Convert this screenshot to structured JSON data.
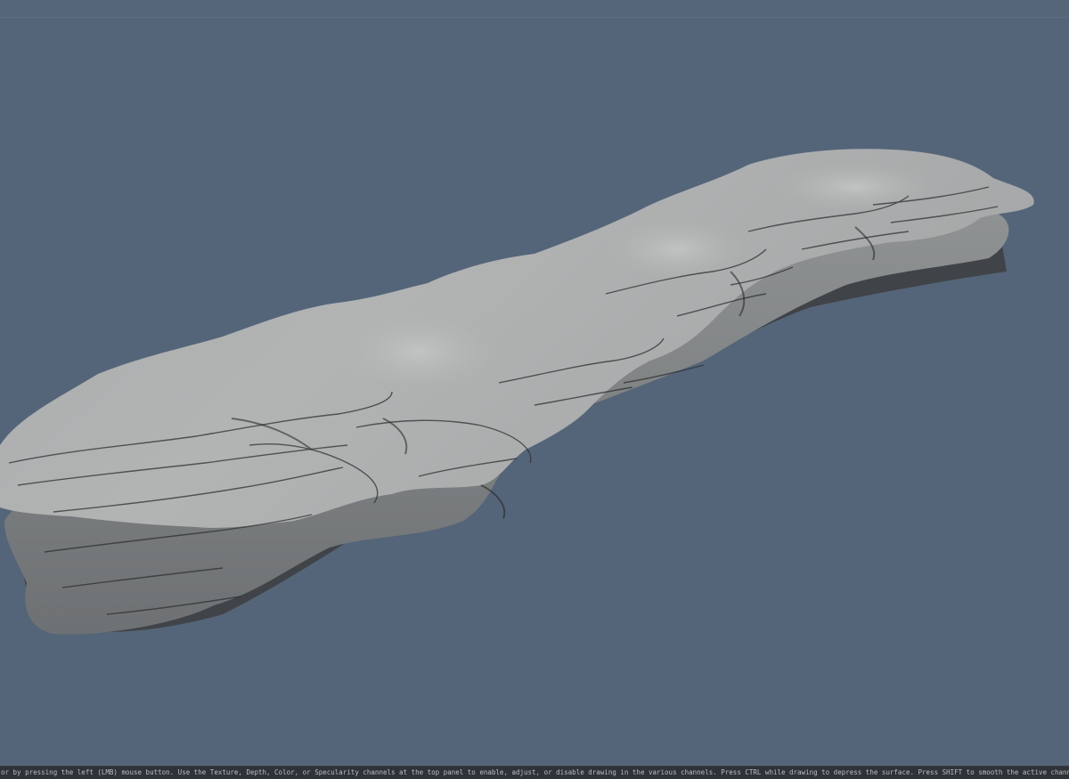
{
  "viewport": {
    "model": "sculpted-rock-slab",
    "background_color": "#55657a",
    "surface_color": "#a4a6a6",
    "shadow_color": "#404143"
  },
  "status_bar": {
    "text": "or by pressing the left (LMB) mouse button. Use the Texture, Depth, Color, or Specularity channels at the top panel to enable, adjust, or disable drawing in the various channels. Press CTRL while drawing to depress the surface. Press SHIFT to smooth the active channel(s) while you draw. Navigate the camera with"
  }
}
